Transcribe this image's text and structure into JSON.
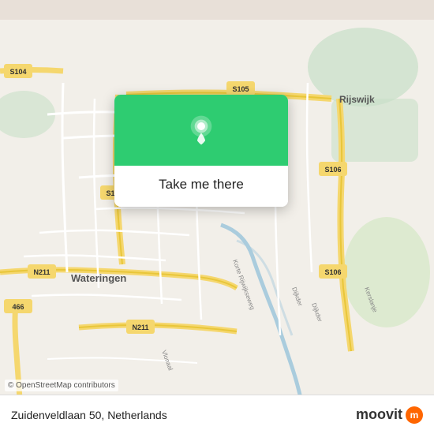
{
  "map": {
    "attribution": "© OpenStreetMap contributors",
    "center_lat": 52.02,
    "center_lon": 4.31,
    "bg_color": "#e8e0d8"
  },
  "popup": {
    "button_label": "Take me there",
    "pin_color": "#2ecc71"
  },
  "bottom_bar": {
    "address": "Zuidenveldlaan 50, Netherlands",
    "logo_text": "moovit"
  }
}
